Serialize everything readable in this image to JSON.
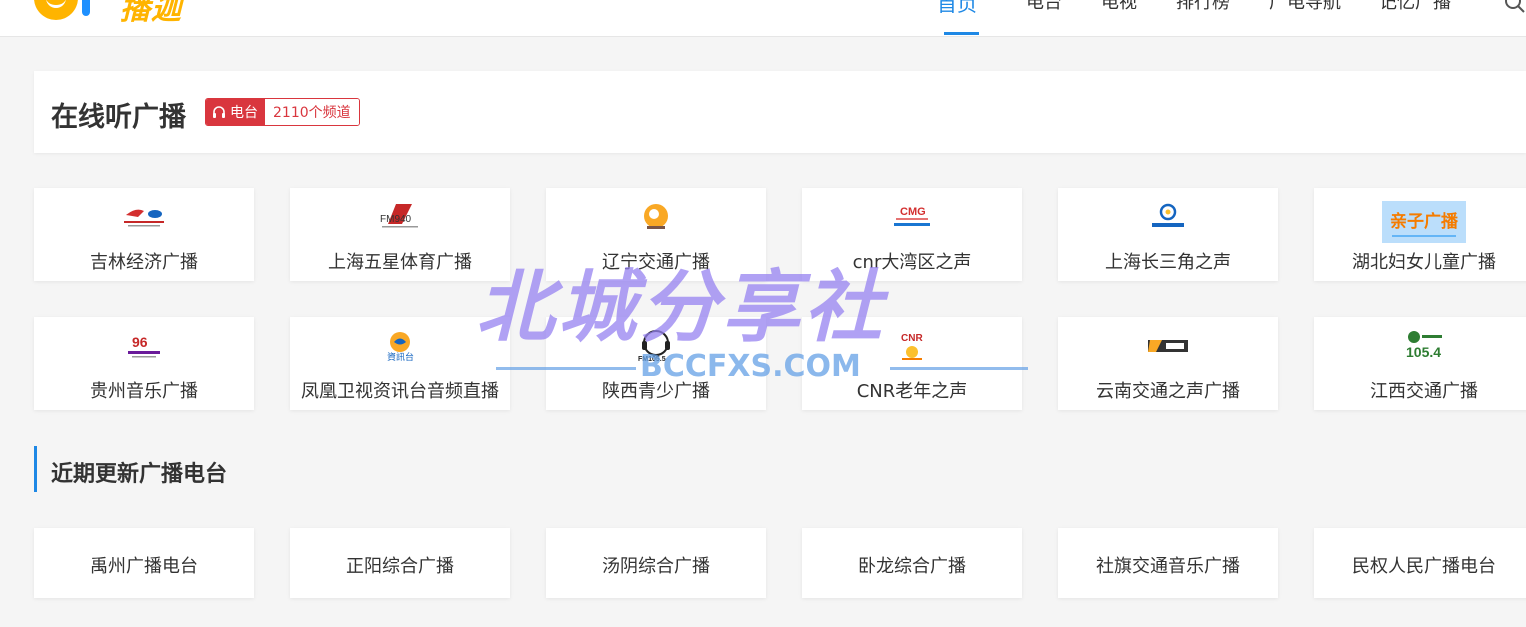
{
  "header": {
    "logo_text": "播迦",
    "nav": [
      "首页",
      "电台",
      "电视",
      "排行榜",
      "广电导航",
      "记忆广播"
    ],
    "active_nav": "首页"
  },
  "title_section": {
    "title": "在线听广播",
    "badge_label": "电台",
    "badge_count": "2110个频道"
  },
  "stations": [
    {
      "name": "吉林经济广播",
      "icon": "jilin-economy-logo"
    },
    {
      "name": "上海五星体育广播",
      "icon": "fm940-logo"
    },
    {
      "name": "辽宁交通广播",
      "icon": "liaoning-traffic-logo"
    },
    {
      "name": "cnr大湾区之声",
      "icon": "cmg-logo"
    },
    {
      "name": "上海长三角之声",
      "icon": "yangtze-delta-logo"
    },
    {
      "name": "湖北妇女儿童广播",
      "icon": "hubei-parent-child-logo"
    },
    {
      "name": "贵州音乐广播",
      "icon": "guizhou-music-logo"
    },
    {
      "name": "凤凰卫视资讯台音频直播",
      "icon": "phoenix-info-logo"
    },
    {
      "name": "陕西青少广播",
      "icon": "fm1055-logo"
    },
    {
      "name": "CNR老年之声",
      "icon": "cnr-logo"
    },
    {
      "name": "云南交通之声广播",
      "icon": "yunnan-traffic-logo"
    },
    {
      "name": "江西交通广播",
      "icon": "jiangxi-1054-logo"
    }
  ],
  "station_logo_text": {
    "fm940": "FM940",
    "cmg": "CMG",
    "qinzi": "亲子广播",
    "fm1055": "FM105.5",
    "cnr": "CNR",
    "jx": "105.4",
    "zixun": "資訊台"
  },
  "recent_section": {
    "title": "近期更新广播电台",
    "items": [
      "禹州广播电台",
      "正阳综合广播",
      "汤阴综合广播",
      "卧龙综合广播",
      "社旗交通音乐广播",
      "民权人民广播电台"
    ]
  },
  "watermark": {
    "main": "北城分享社",
    "sub": "BCCFXS.COM"
  },
  "colors": {
    "accent": "#1e88e5",
    "badge_red": "#d9363e",
    "logo_yellow": "#ffb400"
  }
}
